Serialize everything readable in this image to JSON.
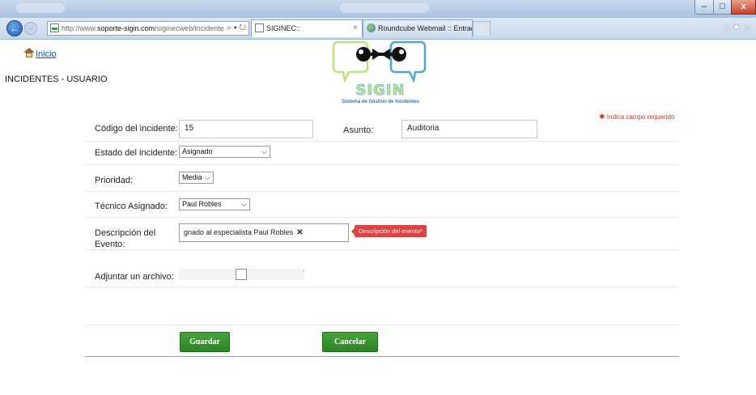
{
  "browser": {
    "address_prefix": "http://www.",
    "address_domain": "soporte-sigin.com",
    "address_suffix": "/siginecweb/incidente",
    "address_tools": "⌕ ▾ ↻",
    "tabs": [
      {
        "title": "SIGINEC::",
        "close": "×",
        "active": true
      },
      {
        "title": "Roundcube Webmail :: Entrada",
        "active": false
      }
    ],
    "window_buttons": {
      "minimize": "–",
      "maximize": "□",
      "close": "x"
    },
    "tool_icons": "⌂★☼"
  },
  "nav": {
    "home_label": "Inicio"
  },
  "page": {
    "title": "INCIDENTES - USUARIO"
  },
  "logo": {
    "name": "SIGIN",
    "subtitle": "Sistema de Gestion de Incidentes"
  },
  "required_note": {
    "marker": "✱",
    "text": "Indica campo requerido"
  },
  "form": {
    "codigo": {
      "label": "Código del incidente:",
      "value": "15"
    },
    "asunto": {
      "label": "Asunto:",
      "value": "Auditoria"
    },
    "estado": {
      "label": "Estado del incidente:",
      "value": "Asignado"
    },
    "prioridad": {
      "label": "Prioridad:",
      "value": "Media"
    },
    "tecnico": {
      "label": "Técnico Asignado:",
      "value": "Paul Robles"
    },
    "descripcion": {
      "label_line1": "Descripción del",
      "label_line2": "Evento:",
      "value": "gnado al especialista Paul Robles",
      "clear": "✕",
      "tooltip": "Descripción del evento*"
    },
    "adjuntar": {
      "label": "Adjuntar un archivo:",
      "dash": "-"
    }
  },
  "buttons": {
    "save": "Guardar",
    "cancel": "Cancelar"
  },
  "colors": {
    "button_green": "#359530",
    "link_blue": "#1a4fb5",
    "required_red": "#c0392b",
    "tooltip_red": "#d94545"
  }
}
